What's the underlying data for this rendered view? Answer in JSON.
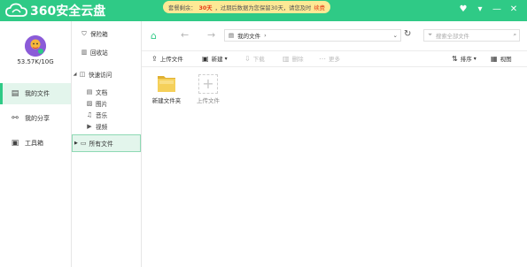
{
  "app": {
    "logo_text": "360安全云盘",
    "accent_color": "#2fca86",
    "banner": {
      "prefix": "套餐剩余：",
      "days": "30天",
      "suffix": "，过期后数据为您保留30天，请您及时",
      "action": "续费"
    },
    "window_controls": [
      "heart-icon",
      "chevron-down-icon",
      "minimize-icon",
      "close-icon"
    ]
  },
  "sidebar": {
    "quota": "53.57K/10G",
    "items": [
      {
        "label": "我的文件",
        "icon": "folder-file-icon",
        "active": true
      },
      {
        "label": "我的分享",
        "icon": "share-icon",
        "active": false
      },
      {
        "label": "工具箱",
        "icon": "toolbox-icon",
        "active": false
      }
    ]
  },
  "tree": {
    "safe": "保险箱",
    "recycle": "回收站",
    "quick": "快速访问",
    "quick_items": [
      {
        "label": "文档",
        "icon": "document-icon"
      },
      {
        "label": "图片",
        "icon": "image-icon"
      },
      {
        "label": "音乐",
        "icon": "music-icon"
      },
      {
        "label": "视频",
        "icon": "video-icon"
      }
    ],
    "all_files": "所有文件"
  },
  "toolbar": {
    "path": "我的文件",
    "search_placeholder": "搜索全部文件",
    "upload": "上传文件",
    "new": "新建",
    "download": "下载",
    "delete": "删除",
    "more": "更多",
    "sort": "排序",
    "view": "视图"
  },
  "files": [
    {
      "name": "新建文件夹",
      "type": "folder"
    }
  ],
  "upload_tile": "上传文件"
}
